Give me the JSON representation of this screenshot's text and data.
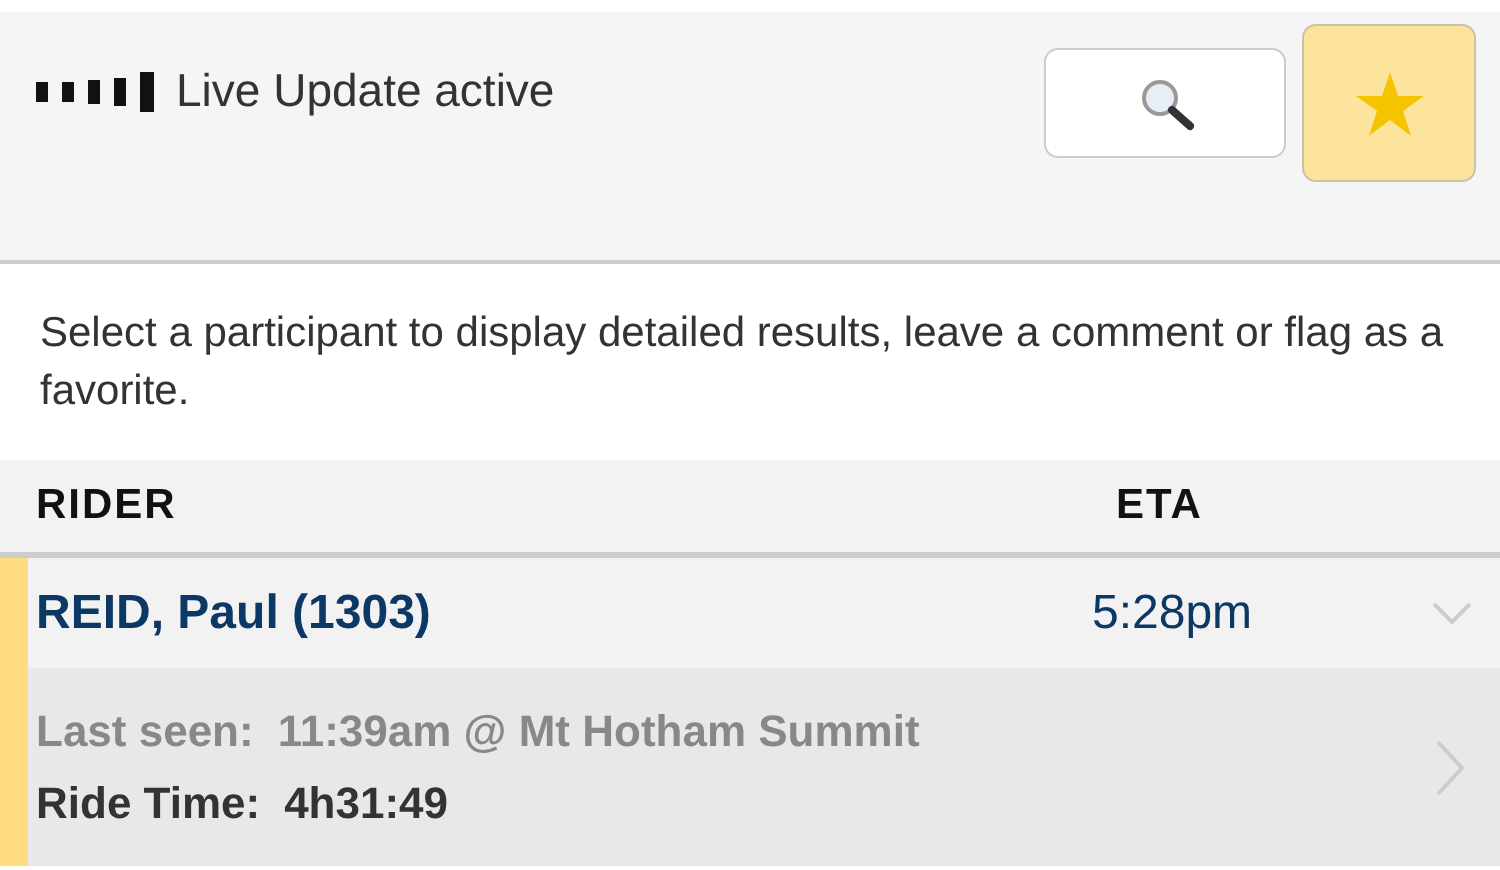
{
  "status": {
    "label": "Live Update active"
  },
  "favorites_filter": {
    "selected": true
  },
  "intro": "Select a participant to display detailed results, leave a comment or flag as a favorite.",
  "columns": [
    "RIDER",
    "ETA"
  ],
  "riders": [
    {
      "name": "REID, Paul (1303)",
      "eta": "5:28pm",
      "favorite": true,
      "expanded": true,
      "last_seen_label": "Last seen:",
      "last_seen": "11:39am @ Mt Hotham Summit",
      "ride_time_label": "Ride Time:",
      "ride_time": "4h31:49"
    }
  ]
}
